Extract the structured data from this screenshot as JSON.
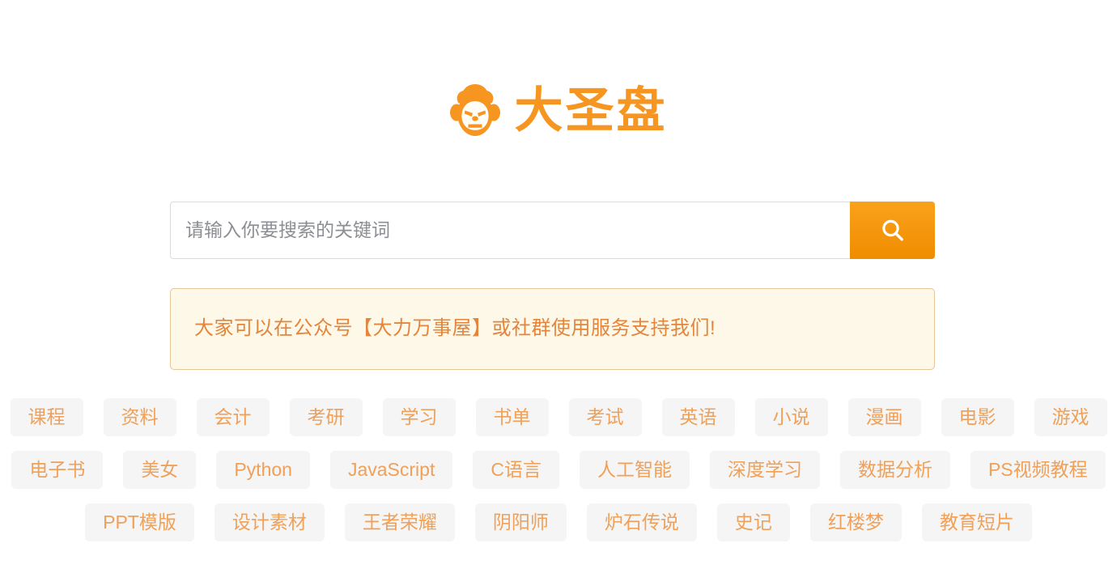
{
  "site": {
    "logo_text": "大圣盘",
    "logo_icon": "monkey-head-icon",
    "brand_color": "#F79521"
  },
  "search": {
    "placeholder": "请输入你要搜索的关键词",
    "value": "",
    "button_icon": "search-icon",
    "button_color": "#F08C00"
  },
  "notice": {
    "text": "大家可以在公众号【大力万事屋】或社群使用服务支持我们!",
    "background": "#FDF8E8",
    "border_color": "#E5C59A",
    "text_color": "#E5853B"
  },
  "tags": {
    "background": "#F5F5F5",
    "text_color": "#EFA059",
    "rows": [
      [
        {
          "label": "课程"
        },
        {
          "label": "资料"
        },
        {
          "label": "会计"
        },
        {
          "label": "考研"
        },
        {
          "label": "学习"
        },
        {
          "label": "书单"
        },
        {
          "label": "考试"
        },
        {
          "label": "英语"
        },
        {
          "label": "小说"
        },
        {
          "label": "漫画"
        },
        {
          "label": "电影"
        },
        {
          "label": "游戏"
        }
      ],
      [
        {
          "label": "电子书"
        },
        {
          "label": "美女"
        },
        {
          "label": "Python"
        },
        {
          "label": "JavaScript"
        },
        {
          "label": "C语言"
        },
        {
          "label": "人工智能"
        },
        {
          "label": "深度学习"
        },
        {
          "label": "数据分析"
        },
        {
          "label": "PS视频教程"
        }
      ],
      [
        {
          "label": "PPT模版"
        },
        {
          "label": "设计素材"
        },
        {
          "label": "王者荣耀"
        },
        {
          "label": "阴阳师"
        },
        {
          "label": "炉石传说"
        },
        {
          "label": "史记"
        },
        {
          "label": "红楼梦"
        },
        {
          "label": "教育短片"
        }
      ]
    ]
  }
}
